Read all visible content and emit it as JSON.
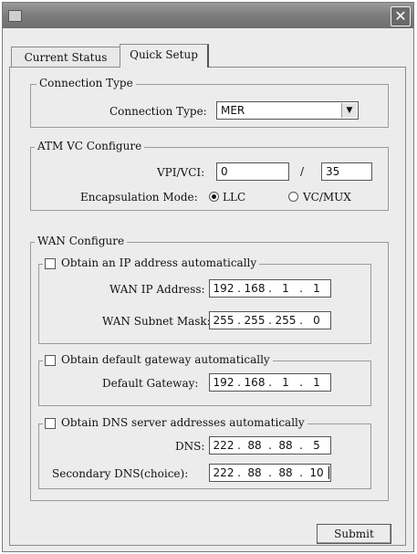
{
  "window": {
    "close_glyph": "✕"
  },
  "tabs": [
    {
      "label": "Current Status",
      "active": false
    },
    {
      "label": "Quick Setup",
      "active": true
    }
  ],
  "connection_type": {
    "legend": "Connection Type",
    "label": "Connection Type:",
    "value": "MER",
    "arrow_glyph": "▼"
  },
  "atm_vc": {
    "legend": "ATM VC Configure",
    "vpivci_label": "VPI/VCI:",
    "vpi": "0",
    "separator": "/",
    "vci": "35",
    "encap_label": "Encapsulation Mode:",
    "options": [
      "LLC",
      "VC/MUX"
    ],
    "selected": "LLC"
  },
  "wan": {
    "legend": "WAN Configure",
    "ip_group": {
      "legend": "Obtain an IP address automatically",
      "checked": false,
      "ip_label": "WAN IP Address:",
      "ip": [
        "192",
        "168",
        "1",
        "1"
      ],
      "mask_label": "WAN Subnet Mask:",
      "mask": [
        "255",
        "255",
        "255",
        "0"
      ]
    },
    "gw_group": {
      "legend": "Obtain default gateway automatically",
      "checked": false,
      "gw_label": "Default Gateway:",
      "gw": [
        "192",
        "168",
        "1",
        "1"
      ]
    },
    "dns_group": {
      "legend": "Obtain DNS server addresses automatically",
      "checked": false,
      "dns_label": "DNS:",
      "dns": [
        "222",
        "88",
        "88",
        "5"
      ],
      "dns2_label": "Secondary DNS(choice):",
      "dns2": [
        "222",
        "88",
        "88",
        "10"
      ]
    }
  },
  "submit_label": "Submit"
}
